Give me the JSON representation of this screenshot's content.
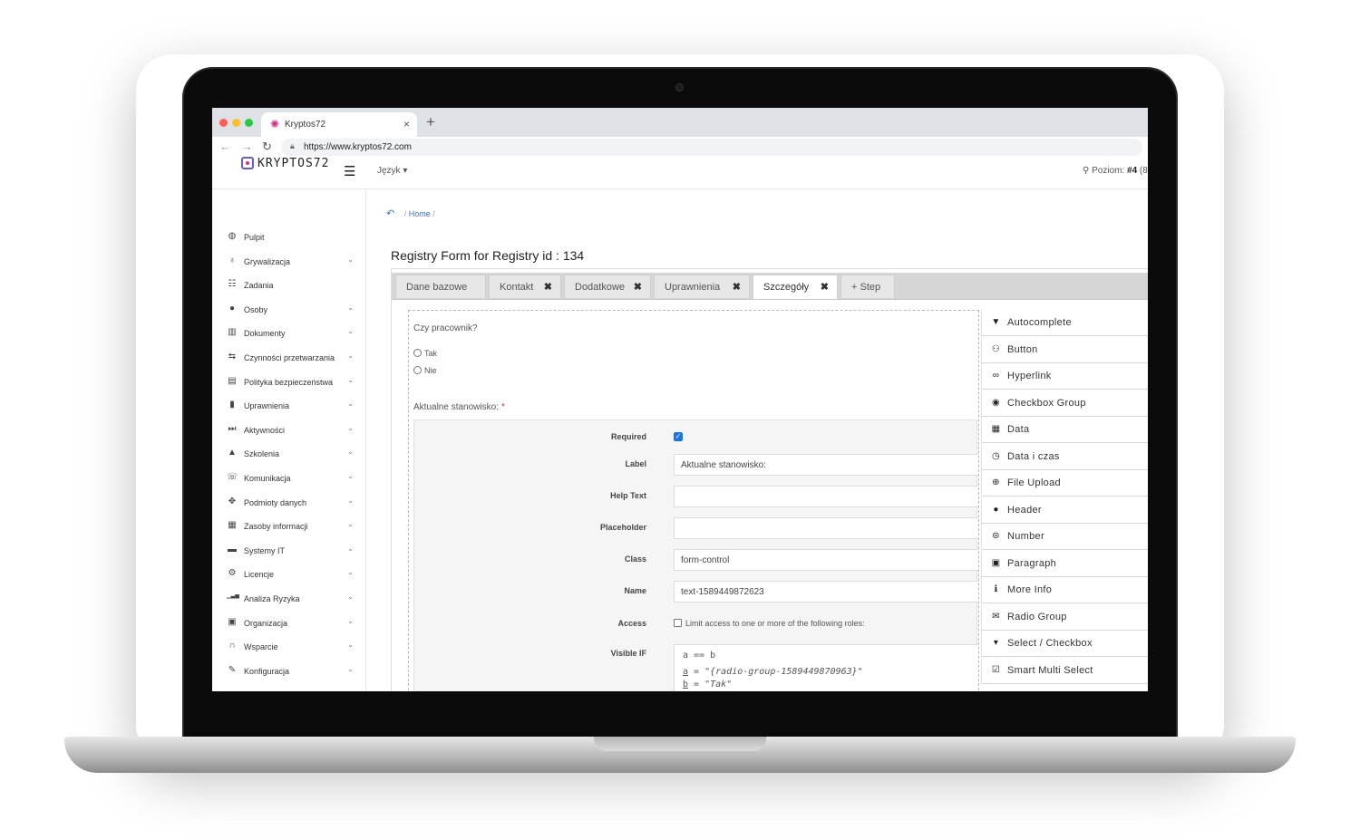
{
  "browser": {
    "tab_title": "Kryptos72",
    "url": "https://www.kryptos72.com"
  },
  "header": {
    "logo_text": "KRYPTOS72",
    "language_label": "Język ▾",
    "level_label": "Poziom:",
    "level_value": "#4",
    "level_suffix": "(8"
  },
  "sidebar": {
    "items": [
      {
        "label": "Pulpit",
        "icon": "globe-icon",
        "glyph": "◍",
        "has_chevron": false
      },
      {
        "label": "Grywalizacja",
        "icon": "bulb-icon",
        "glyph": "♁",
        "has_chevron": true
      },
      {
        "label": "Zadania",
        "icon": "tasks-icon",
        "glyph": "☷",
        "has_chevron": false
      },
      {
        "label": "Osoby",
        "icon": "user-icon",
        "glyph": "●",
        "has_chevron": true
      },
      {
        "label": "Dokumenty",
        "icon": "book-icon",
        "glyph": "▥",
        "has_chevron": true
      },
      {
        "label": "Czynności przetwarzania",
        "icon": "retweet-icon",
        "glyph": "⇆",
        "has_chevron": true
      },
      {
        "label": "Polityka bezpieczeństwa",
        "icon": "print-icon",
        "glyph": "▤",
        "has_chevron": true
      },
      {
        "label": "Uprawnienia",
        "icon": "lock-icon",
        "glyph": "▮",
        "has_chevron": true
      },
      {
        "label": "Aktywności",
        "icon": "activity-icon",
        "glyph": "⏭",
        "has_chevron": true
      },
      {
        "label": "Szkolenia",
        "icon": "graduation-icon",
        "glyph": "▲",
        "has_chevron": true
      },
      {
        "label": "Komunikacja",
        "icon": "chat-icon",
        "glyph": "☏",
        "has_chevron": true
      },
      {
        "label": "Podmioty danych",
        "icon": "arrows-icon",
        "glyph": "✥",
        "has_chevron": true
      },
      {
        "label": "Zasoby informacji",
        "icon": "file-icon",
        "glyph": "▦",
        "has_chevron": true
      },
      {
        "label": "Systemy IT",
        "icon": "laptop-icon",
        "glyph": "▬",
        "has_chevron": true
      },
      {
        "label": "Licencje",
        "icon": "cogs-icon",
        "glyph": "⚙",
        "has_chevron": true
      },
      {
        "label": "Analiza Ryzyka",
        "icon": "bar-chart-icon",
        "glyph": "▁▃▅",
        "has_chevron": true
      },
      {
        "label": "Organizacja",
        "icon": "briefcase-icon",
        "glyph": "▣",
        "has_chevron": true
      },
      {
        "label": "Wsparcie",
        "icon": "headphones-icon",
        "glyph": "∩",
        "has_chevron": true
      },
      {
        "label": "Konfiguracja",
        "icon": "wrench-icon",
        "glyph": "✎",
        "has_chevron": true
      }
    ]
  },
  "breadcrumb": {
    "back_glyph": "↶",
    "home": "Home",
    "separator": "/"
  },
  "page_title": "Registry Form for Registry id : 134",
  "tabs": [
    {
      "label": "Dane bazowe",
      "closable": false,
      "active": false
    },
    {
      "label": "Kontakt",
      "closable": true,
      "active": false
    },
    {
      "label": "Dodatkowe",
      "closable": true,
      "active": false
    },
    {
      "label": "Uprawnienia",
      "closable": true,
      "active": false
    },
    {
      "label": "Szczegóły",
      "closable": true,
      "active": true
    },
    {
      "label": "+ Step",
      "closable": false,
      "active": false
    }
  ],
  "stage": {
    "question": "Czy pracownik?",
    "options": [
      "Tak",
      "Nie"
    ],
    "field_title": "Aktualne stanowisko:",
    "required_mark": "*",
    "props": {
      "required_label": "Required",
      "label_label": "Label",
      "label_value": "Aktualne stanowisko:",
      "help_label": "Help Text",
      "help_value": "",
      "placeholder_label": "Placeholder",
      "placeholder_value": "",
      "class_label": "Class",
      "class_value": "form-control",
      "name_label": "Name",
      "name_value": "text-1589449872623",
      "access_label": "Access",
      "access_text": "Limit access to one or more of the following roles:",
      "visible_label": "Visible IF",
      "visible_line1": "a == b",
      "visible_a_var": "a",
      "visible_a_value": "\"{radio-group-1589449870963}\"",
      "visible_b_var": "b",
      "visible_b_value": "\"Tak\"",
      "eq": " = "
    }
  },
  "palette": [
    {
      "label": "Autocomplete",
      "icon": "filter-icon",
      "glyph": "▼"
    },
    {
      "label": "Button",
      "icon": "users-icon",
      "glyph": "⚇"
    },
    {
      "label": "Hyperlink",
      "icon": "link-icon",
      "glyph": "∞"
    },
    {
      "label": "Checkbox Group",
      "icon": "check-circle-icon",
      "glyph": "◉"
    },
    {
      "label": "Data",
      "icon": "calendar-icon",
      "glyph": "▦"
    },
    {
      "label": "Data i czas",
      "icon": "clock-icon",
      "glyph": "◷"
    },
    {
      "label": "File Upload",
      "icon": "upload-icon",
      "glyph": "⊕"
    },
    {
      "label": "Header",
      "icon": "user-icon",
      "glyph": "●"
    },
    {
      "label": "Number",
      "icon": "number-icon",
      "glyph": "⊜"
    },
    {
      "label": "Paragraph",
      "icon": "paragraph-icon",
      "glyph": "▣"
    },
    {
      "label": "More Info",
      "icon": "info-icon",
      "glyph": "ℹ"
    },
    {
      "label": "Radio Group",
      "icon": "envelope-icon",
      "glyph": "✉"
    },
    {
      "label": "Select / Checkbox",
      "icon": "select-icon",
      "glyph": "▾"
    },
    {
      "label": "Smart Multi Select",
      "icon": "checkbox-icon",
      "glyph": "☑"
    }
  ]
}
